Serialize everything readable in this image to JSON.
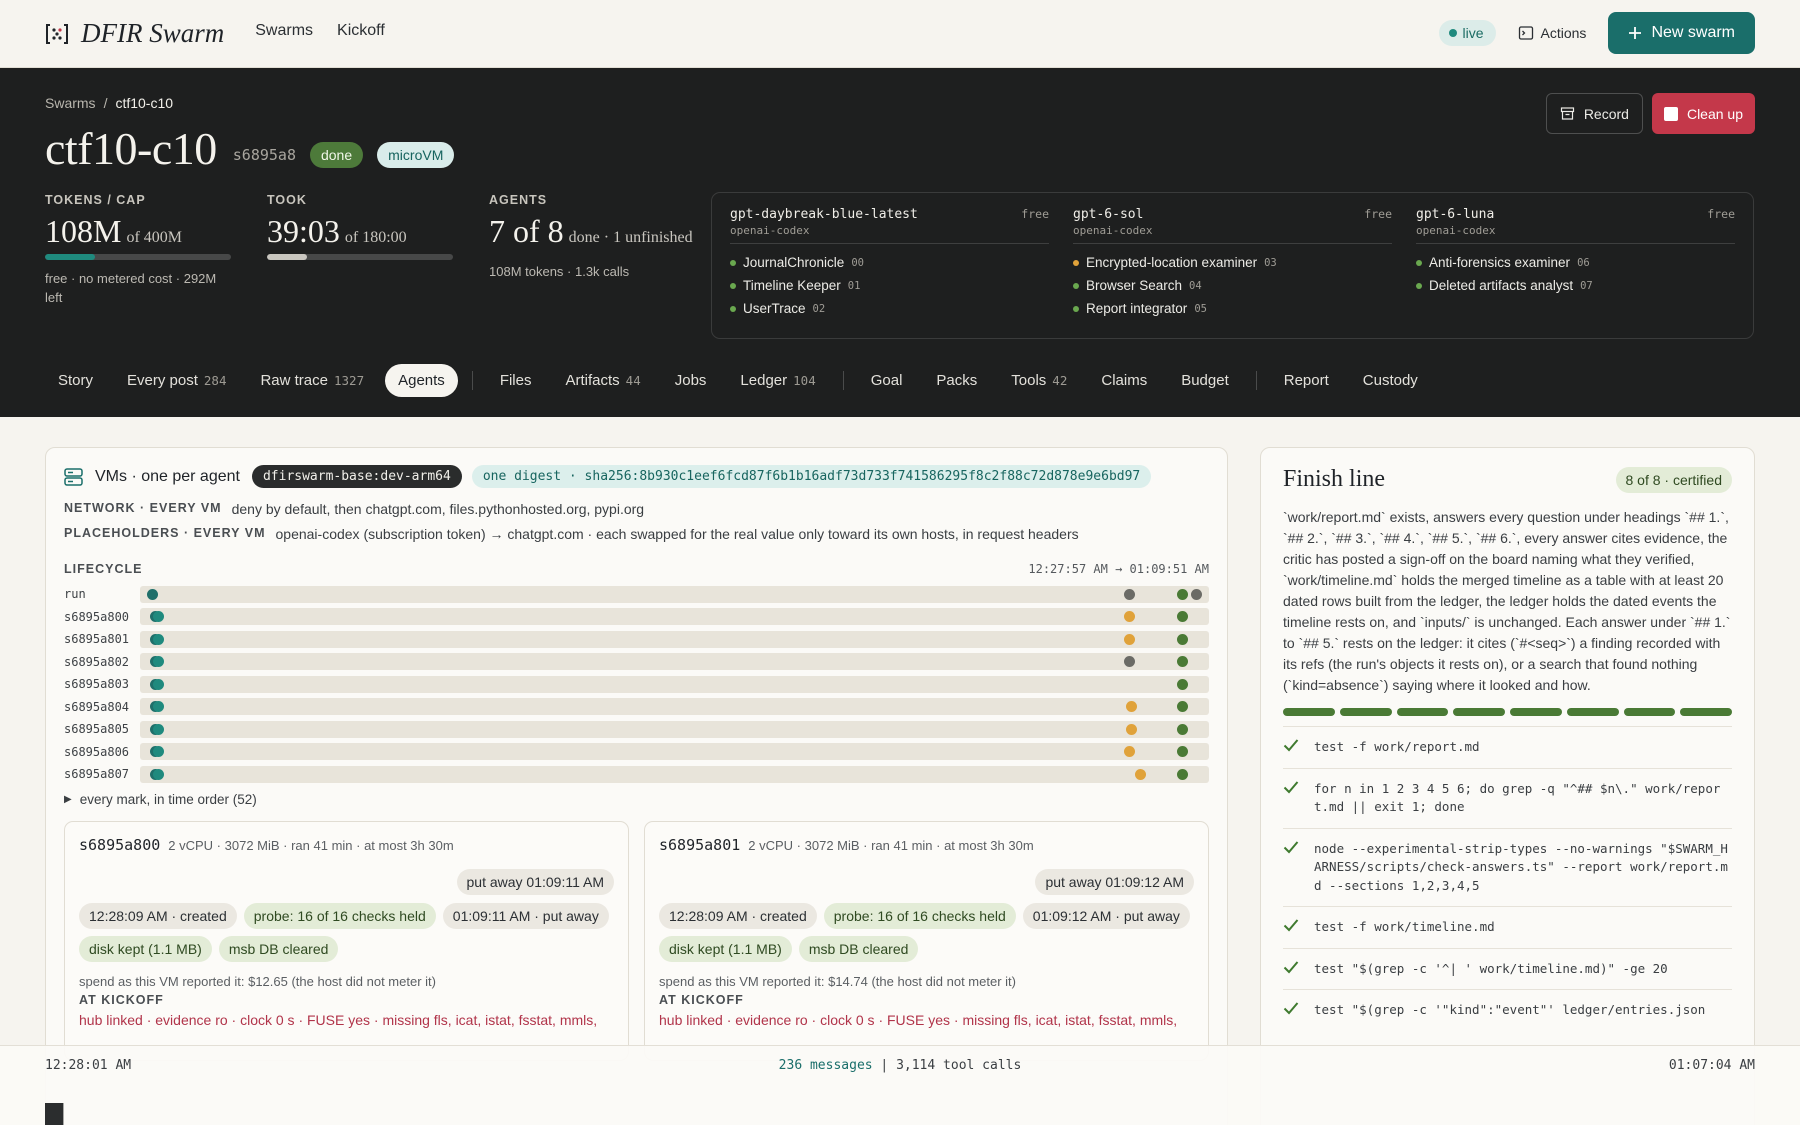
{
  "app": {
    "title": "DFIR Swarm",
    "nav": [
      "Swarms",
      "Kickoff"
    ],
    "live_label": "live",
    "actions_label": "Actions",
    "new_swarm_label": "New swarm"
  },
  "breadcrumb": {
    "root": "Swarms",
    "separator": "/",
    "current": "ctf10-c10"
  },
  "run": {
    "title": "ctf10-c10",
    "id": "s6895a8",
    "status": "done",
    "kind": "microVM",
    "record_label": "Record",
    "cleanup_label": "Clean up"
  },
  "stats": {
    "tokens": {
      "label": "TOKENS / CAP",
      "value": "108M",
      "cap": "of 400M",
      "fraction": 0.27,
      "note": "free · no metered cost · 292M left",
      "color": "#1f8a7e"
    },
    "took": {
      "label": "TOOK",
      "value": "39:03",
      "cap": "of 180:00",
      "fraction": 0.217,
      "color": "#c9c6bf"
    },
    "agents": {
      "label": "AGENTS",
      "value": "7 of 8",
      "detail": "done · 1 unfinished",
      "note": "108M tokens · 1.3k calls"
    }
  },
  "models": [
    {
      "name": "gpt-daybreak-blue-latest",
      "provider": "openai-codex",
      "tier": "free",
      "agents": [
        {
          "name": "JournalChronicle",
          "num": "00",
          "color": "#6aa84f"
        },
        {
          "name": "Timeline Keeper",
          "num": "01",
          "color": "#6aa84f"
        },
        {
          "name": "UserTrace",
          "num": "02",
          "color": "#6aa84f"
        }
      ]
    },
    {
      "name": "gpt-6-sol",
      "provider": "openai-codex",
      "tier": "free",
      "agents": [
        {
          "name": "Encrypted-location examiner",
          "num": "03",
          "color": "#e0a23a"
        },
        {
          "name": "Browser Search",
          "num": "04",
          "color": "#6aa84f"
        },
        {
          "name": "Report integrator",
          "num": "05",
          "color": "#6aa84f"
        }
      ]
    },
    {
      "name": "gpt-6-luna",
      "provider": "openai-codex",
      "tier": "free",
      "agents": [
        {
          "name": "Anti-forensics examiner",
          "num": "06",
          "color": "#6aa84f"
        },
        {
          "name": "Deleted artifacts analyst",
          "num": "07",
          "color": "#6aa84f"
        }
      ]
    }
  ],
  "tabs": [
    {
      "label": "Story",
      "count": ""
    },
    {
      "label": "Every post",
      "count": "284"
    },
    {
      "label": "Raw trace",
      "count": "1327"
    },
    {
      "label": "Agents",
      "count": "",
      "active": true
    },
    {
      "sep": true
    },
    {
      "label": "Files",
      "count": ""
    },
    {
      "label": "Artifacts",
      "count": "44"
    },
    {
      "label": "Jobs",
      "count": ""
    },
    {
      "label": "Ledger",
      "count": "104"
    },
    {
      "sep": true
    },
    {
      "label": "Goal",
      "count": ""
    },
    {
      "label": "Packs",
      "count": ""
    },
    {
      "label": "Tools",
      "count": "42"
    },
    {
      "label": "Claims",
      "count": ""
    },
    {
      "label": "Budget",
      "count": ""
    },
    {
      "sep": true
    },
    {
      "label": "Report",
      "count": ""
    },
    {
      "label": "Custody",
      "count": ""
    }
  ],
  "vms": {
    "title": "VMs · one per agent",
    "image": "dfirswarm-base:dev-arm64",
    "digest": "one digest · sha256:8b930c1eef6fcd87f6b1b16adf73d733f741586295f8c2f88c72d878e9e6bd97",
    "network_label": "NETWORK · EVERY VM",
    "network": "deny by default, then chatgpt.com, files.pythonhosted.org, pypi.org",
    "placeholders_label": "PLACEHOLDERS · EVERY VM",
    "placeholders": "openai-codex (subscription token) → chatgpt.com · each swapped for the real value only toward its own hosts, in request headers",
    "lifecycle_label": "LIFECYCLE",
    "lifecycle_range": "12:27:57 AM → 01:09:51 AM",
    "lanes": [
      {
        "name": "run",
        "marks": [
          {
            "t": 0.007,
            "c": "#1f6f6a"
          },
          {
            "t": 0.93,
            "c": "#6b6b66"
          },
          {
            "t": 0.98,
            "c": "#4a7a35"
          },
          {
            "t": 0.993,
            "c": "#6b6b66"
          }
        ]
      },
      {
        "name": "s6895a800",
        "marks": [
          {
            "t": 0.012,
            "c": "#1f8a7e",
            "ring": true
          },
          {
            "t": 0.93,
            "c": "#e0a23a"
          },
          {
            "t": 0.98,
            "c": "#4a7a35"
          }
        ]
      },
      {
        "name": "s6895a801",
        "marks": [
          {
            "t": 0.012,
            "c": "#1f8a7e",
            "ring": true
          },
          {
            "t": 0.93,
            "c": "#e0a23a"
          },
          {
            "t": 0.98,
            "c": "#4a7a35"
          }
        ]
      },
      {
        "name": "s6895a802",
        "marks": [
          {
            "t": 0.012,
            "c": "#1f8a7e",
            "ring": true
          },
          {
            "t": 0.93,
            "c": "#6b6b66"
          },
          {
            "t": 0.98,
            "c": "#4a7a35"
          }
        ]
      },
      {
        "name": "s6895a803",
        "marks": [
          {
            "t": 0.012,
            "c": "#1f8a7e",
            "ring": true
          },
          {
            "t": 0.98,
            "c": "#4a7a35"
          }
        ]
      },
      {
        "name": "s6895a804",
        "marks": [
          {
            "t": 0.012,
            "c": "#1f8a7e",
            "ring": true
          },
          {
            "t": 0.932,
            "c": "#e0a23a"
          },
          {
            "t": 0.98,
            "c": "#4a7a35"
          }
        ]
      },
      {
        "name": "s6895a805",
        "marks": [
          {
            "t": 0.012,
            "c": "#1f8a7e",
            "ring": true
          },
          {
            "t": 0.932,
            "c": "#e0a23a"
          },
          {
            "t": 0.98,
            "c": "#4a7a35"
          }
        ]
      },
      {
        "name": "s6895a806",
        "marks": [
          {
            "t": 0.012,
            "c": "#1f8a7e",
            "ring": true
          },
          {
            "t": 0.93,
            "c": "#e0a23a"
          },
          {
            "t": 0.98,
            "c": "#4a7a35"
          }
        ]
      },
      {
        "name": "s6895a807",
        "marks": [
          {
            "t": 0.012,
            "c": "#1f8a7e",
            "ring": true
          },
          {
            "t": 0.94,
            "c": "#e0a23a"
          },
          {
            "t": 0.98,
            "c": "#4a7a35"
          }
        ]
      }
    ],
    "every_mark_label": "every mark, in time order (52)",
    "cards": [
      {
        "id": "s6895a800",
        "meta": "2 vCPU · 3072 MiB · ran 41 min · at most 3h 30m",
        "put_away": "put away 01:09:11 AM",
        "chips": [
          {
            "text": "12:28:09 AM · created",
            "kind": "gray"
          },
          {
            "text": "probe: 16 of 16 checks held",
            "kind": "green"
          },
          {
            "text": "01:09:11 AM · put away",
            "kind": "gray"
          },
          {
            "text": "disk kept (1.1 MB)",
            "kind": "green"
          },
          {
            "text": "msb DB cleared",
            "kind": "green"
          }
        ],
        "spend": "spend as this VM reported it: $12.65 (the host did not meter it)",
        "kickoff_label": "AT KICKOFF",
        "kickoff": "hub linked · evidence ro · clock 0 s · FUSE yes · missing fls, icat, istat, fsstat, mmls,"
      },
      {
        "id": "s6895a801",
        "meta": "2 vCPU · 3072 MiB · ran 41 min · at most 3h 30m",
        "put_away": "put away 01:09:12 AM",
        "chips": [
          {
            "text": "12:28:09 AM · created",
            "kind": "gray"
          },
          {
            "text": "probe: 16 of 16 checks held",
            "kind": "green"
          },
          {
            "text": "01:09:12 AM · put away",
            "kind": "gray"
          },
          {
            "text": "disk kept (1.1 MB)",
            "kind": "green"
          },
          {
            "text": "msb DB cleared",
            "kind": "green"
          }
        ],
        "spend": "spend as this VM reported it: $14.74 (the host did not meter it)",
        "kickoff_label": "AT KICKOFF",
        "kickoff": "hub linked · evidence ro · clock 0 s · FUSE yes · missing fls, icat, istat, fsstat, mmls,"
      }
    ]
  },
  "finish": {
    "title": "Finish line",
    "badge": "8 of 8 · certified",
    "text": "`work/report.md` exists, answers every question under headings `## 1.`, `## 2.`, `## 3.`, `## 4.`, `## 5.`, `## 6.`, every answer cites evidence, the critic has posted a sign-off on the board naming what they verified, `work/timeline.md` holds the merged timeline as a table with at least 20 dated rows built from the ledger, the ledger holds the dated events the timeline rests on, and `inputs/` is unchanged. Each answer under `## 1.` to `## 5.` rests on the ledger: it cites (`#<seq>`) a finding recorded with its refs (the run's objects it rests on), or a search that found nothing (`kind=absence`) saying where it looked and how.",
    "segments": 8,
    "checks": [
      "test -f work/report.md",
      "for n in 1 2 3 4 5 6; do grep -q \"^## $n\\.\" work/report.md || exit 1; done",
      "node --experimental-strip-types --no-warnings \"$SWARM_HARNESS/scripts/check-answers.ts\" --report work/report.md --sections 1,2,3,4,5",
      "test -f work/timeline.md",
      "test \"$(grep -c '^| ' work/timeline.md)\" -ge 20",
      "test \"$(grep -c '\"kind\":\"event\"' ledger/entries.json"
    ]
  },
  "footer": {
    "start": "12:28:01 AM",
    "messages": "236 messages",
    "divider": "|",
    "tool_calls": "3,114 tool calls",
    "end": "01:07:04 AM",
    "histogram": [
      28,
      9,
      3,
      3,
      2,
      2,
      3,
      4,
      2,
      3,
      3,
      4,
      5,
      3,
      3,
      4,
      3,
      2,
      3,
      4,
      2,
      3,
      3,
      2,
      2,
      3,
      4,
      3,
      2,
      3,
      2,
      3,
      2,
      2,
      3,
      4,
      3,
      2,
      2,
      3,
      3,
      2,
      2,
      3,
      2,
      3,
      2,
      2,
      3,
      2,
      3,
      4,
      3,
      2,
      3,
      2,
      2,
      2,
      3,
      3,
      2,
      3,
      2,
      2,
      3,
      2,
      3,
      2,
      2,
      2,
      3,
      2,
      3,
      2,
      2,
      3,
      2,
      2,
      3,
      2,
      2,
      2,
      3,
      2
    ]
  }
}
